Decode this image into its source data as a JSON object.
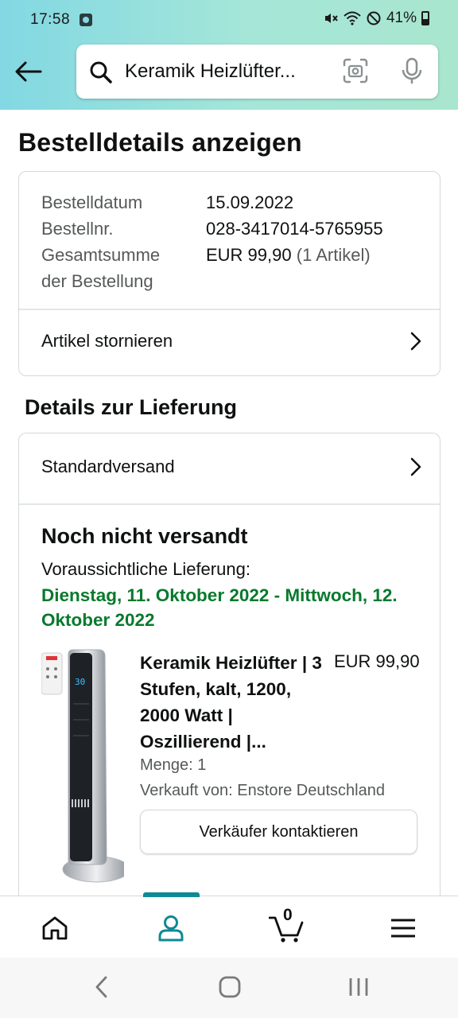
{
  "status_bar": {
    "time": "17:58",
    "battery": "41%",
    "icons": [
      "sim-icon",
      "mute-icon",
      "wifi-icon",
      "dnd-icon",
      "battery-icon"
    ]
  },
  "search": {
    "query": "Keramik Heizlüfter...",
    "icons": [
      "back-arrow-icon",
      "search-icon",
      "camera-scan-icon",
      "mic-icon"
    ]
  },
  "page": {
    "title": "Bestelldetails anzeigen"
  },
  "order": {
    "date_label": "Bestelldatum",
    "date": "15.09.2022",
    "number_label": "Bestellnr.",
    "number": "028-3417014-5765955",
    "total_label_1": "Gesamtsumme",
    "total_label_2": "der Bestellung",
    "total": "EUR 99,90",
    "total_items": "(1 Artikel)",
    "cancel_label": "Artikel stornieren"
  },
  "delivery": {
    "section_title": "Details zur Lieferung",
    "shipping_method": "Standardversand",
    "status": "Noch nicht versandt",
    "eta_label": "Voraussichtliche Lieferung:",
    "eta": "Dienstag, 11. Oktober 2022 - Mittwoch, 12. Oktober 2022"
  },
  "product": {
    "name": "Keramik Heizlüfter | 3 Stufen, kalt, 1200, 2000 Watt | Oszillierend |...",
    "price": "EUR 99,90",
    "quantity": "Menge: 1",
    "seller": "Verkauft von: Enstore Deutschland",
    "contact_button": "Verkäufer kontaktieren",
    "display_reading": "30"
  },
  "bottom_nav": {
    "items": [
      "home-icon",
      "account-icon",
      "cart-icon",
      "menu-icon"
    ],
    "cart_count": "0",
    "active": "account"
  },
  "colors": {
    "header_gradient_start": "#82d8e3",
    "header_gradient_end": "#a9e6cf",
    "eta_green": "#077a2d",
    "nav_accent": "#0e8a95"
  }
}
